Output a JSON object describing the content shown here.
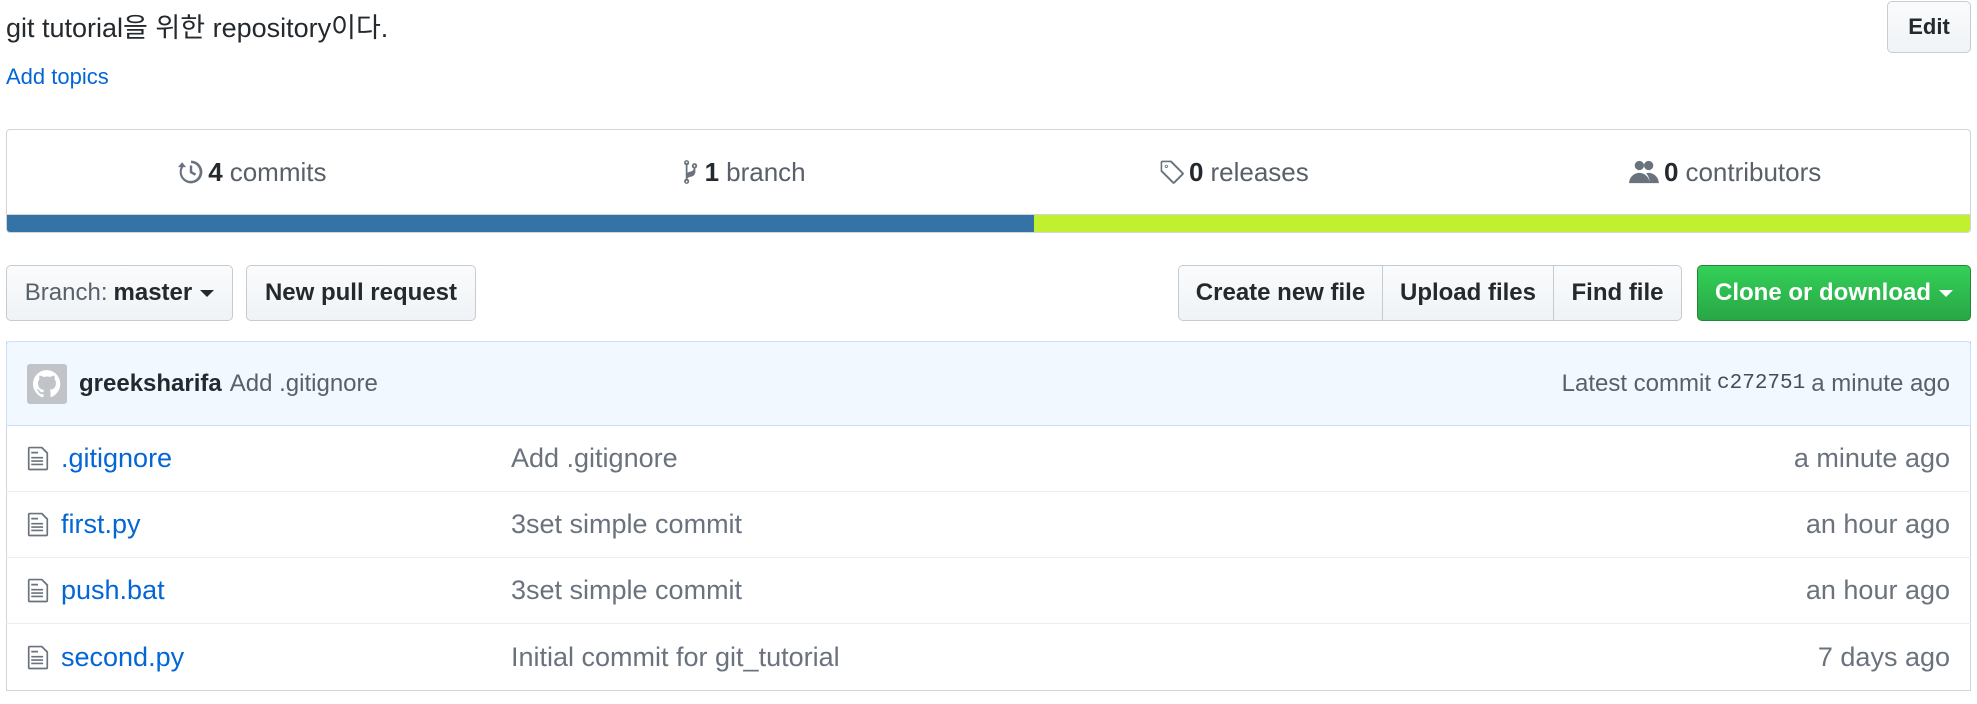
{
  "repo": {
    "description": "git tutorial을 위한 repository이다.",
    "edit_label": "Edit",
    "add_topics_label": "Add topics"
  },
  "summary": {
    "commits": {
      "count": "4",
      "label": "commits",
      "icon": "history-icon"
    },
    "branches": {
      "count": "1",
      "label": "branch",
      "icon": "branch-icon"
    },
    "releases": {
      "count": "0",
      "label": "releases",
      "icon": "tag-icon"
    },
    "contributors": {
      "count": "0",
      "label": "contributors",
      "icon": "people-icon"
    },
    "language_bar": [
      {
        "color": "#3572a5",
        "percent": 52.3
      },
      {
        "color": "#c1f12e",
        "percent": 47.7
      }
    ]
  },
  "toolbar": {
    "branch_prefix": "Branch:",
    "branch_name": "master",
    "new_pr_label": "New pull request",
    "create_file_label": "Create new file",
    "upload_label": "Upload files",
    "find_label": "Find file",
    "clone_label": "Clone or download",
    "clone_color": "#28a745"
  },
  "latest_commit": {
    "author": "greeksharifa",
    "message": "Add .gitignore",
    "prefix": "Latest commit",
    "sha": "c272751",
    "age": "a minute ago"
  },
  "files": [
    {
      "name": ".gitignore",
      "message": "Add .gitignore",
      "age": "a minute ago"
    },
    {
      "name": "first.py",
      "message": "3set simple commit",
      "age": "an hour ago"
    },
    {
      "name": "push.bat",
      "message": "3set simple commit",
      "age": "an hour ago"
    },
    {
      "name": "second.py",
      "message": "Initial commit for git_tutorial",
      "age": "7 days ago"
    }
  ]
}
